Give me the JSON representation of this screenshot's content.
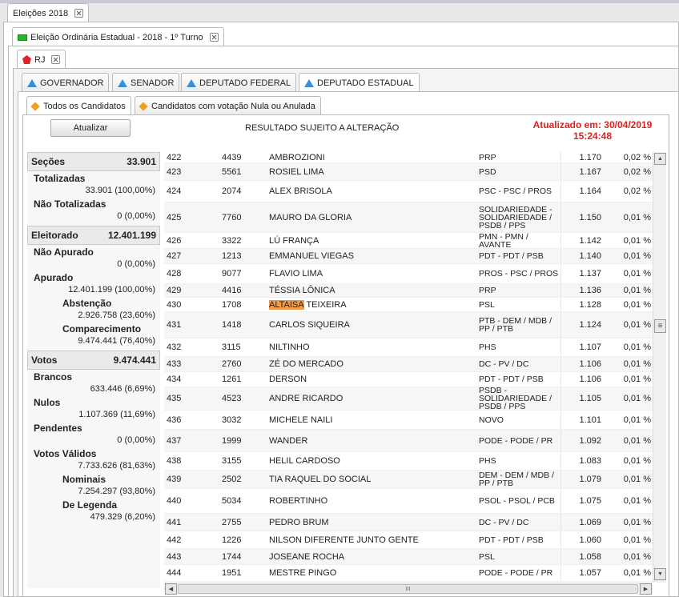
{
  "tabs": {
    "top": "Eleições 2018",
    "election": "Eleição Ordinária Estadual - 2018 - 1º Turno",
    "state": "RJ",
    "offices": [
      "GOVERNADOR",
      "SENADOR",
      "DEPUTADO FEDERAL",
      "DEPUTADO ESTADUAL"
    ],
    "filters": [
      "Todos os Candidatos",
      "Candidatos com votação Nula ou Anulada"
    ]
  },
  "toolbar": {
    "refresh_label": "Atualizar",
    "notice": "RESULTADO SUJEITO A ALTERAÇÃO",
    "updated_line1": "Atualizado em: 30/04/2019",
    "updated_line2": "15:24:48"
  },
  "stats": {
    "secoes_label": "Seções",
    "secoes_value": "33.901",
    "totalizadas_label": "Totalizadas",
    "totalizadas_value": "33.901 (100,00%)",
    "nao_totalizadas_label": "Não Totalizadas",
    "nao_totalizadas_value": "0 (0,00%)",
    "eleitorado_label": "Eleitorado",
    "eleitorado_value": "12.401.199",
    "nao_apurado_label": "Não Apurado",
    "nao_apurado_value": "0 (0,00%)",
    "apurado_label": "Apurado",
    "apurado_value": "12.401.199 (100,00%)",
    "abstencao_label": "Abstenção",
    "abstencao_value": "2.926.758 (23,60%)",
    "comparecimento_label": "Comparecimento",
    "comparecimento_value": "9.474.441 (76,40%)",
    "votos_label": "Votos",
    "votos_value": "9.474.441",
    "brancos_label": "Brancos",
    "brancos_value": "633.446 (6,69%)",
    "nulos_label": "Nulos",
    "nulos_value": "1.107.369 (11,69%)",
    "pendentes_label": "Pendentes",
    "pendentes_value": "0 (0,00%)",
    "validos_label": "Votos Válidos",
    "validos_value": "7.733.626 (81,63%)",
    "nominais_label": "Nominais",
    "nominais_value": "7.254.297 (93,80%)",
    "legenda_label": "De Legenda",
    "legenda_value": "479.329 (6,20%)"
  },
  "candidates": [
    {
      "pos": "422",
      "num": "4439",
      "name": "AMBROZIONI",
      "party": "PRP",
      "votes": "1.170",
      "pct": "0,02 %"
    },
    {
      "pos": "423",
      "num": "5561",
      "name": "ROSIEL LIMA",
      "party": "PSD",
      "votes": "1.167",
      "pct": "0,02 %"
    },
    {
      "pos": "424",
      "num": "2074",
      "name": "ALEX BRISOLA",
      "party": "PSC - PSC / PROS",
      "votes": "1.164",
      "pct": "0,02 %"
    },
    {
      "pos": "425",
      "num": "7760",
      "name": "MAURO DA GLORIA",
      "party": "SOLIDARIEDADE - SOLIDARIEDADE / PSDB / PPS",
      "votes": "1.150",
      "pct": "0,01 %"
    },
    {
      "pos": "426",
      "num": "3322",
      "name": "LÚ FRANÇA",
      "party": "PMN - PMN / AVANTE",
      "votes": "1.142",
      "pct": "0,01 %"
    },
    {
      "pos": "427",
      "num": "1213",
      "name": "EMMANUEL VIEGAS",
      "party": "PDT - PDT / PSB",
      "votes": "1.140",
      "pct": "0,01 %"
    },
    {
      "pos": "428",
      "num": "9077",
      "name": "FLAVIO LIMA",
      "party": "PROS - PSC / PROS",
      "votes": "1.137",
      "pct": "0,01 %"
    },
    {
      "pos": "429",
      "num": "4416",
      "name": "TÉSSIA LÔNICA",
      "party": "PRP",
      "votes": "1.136",
      "pct": "0,01 %"
    },
    {
      "pos": "430",
      "num": "1708",
      "name_hl": "ALTAISA",
      "name_rest": " TEIXEIRA",
      "party": "PSL",
      "votes": "1.128",
      "pct": "0,01 %"
    },
    {
      "pos": "431",
      "num": "1418",
      "name": "CARLOS SIQUEIRA",
      "party": "PTB - DEM / MDB / PP / PTB",
      "votes": "1.124",
      "pct": "0,01 %"
    },
    {
      "pos": "432",
      "num": "3115",
      "name": "NILTINHO",
      "party": "PHS",
      "votes": "1.107",
      "pct": "0,01 %"
    },
    {
      "pos": "433",
      "num": "2760",
      "name": "ZÉ DO MERCADO",
      "party": "DC - PV / DC",
      "votes": "1.106",
      "pct": "0,01 %"
    },
    {
      "pos": "434",
      "num": "1261",
      "name": "DERSON",
      "party": "PDT - PDT / PSB",
      "votes": "1.106",
      "pct": "0,01 %"
    },
    {
      "pos": "435",
      "num": "4523",
      "name": "ANDRE RICARDO",
      "party": "PSDB - SOLIDARIEDADE / PSDB / PPS",
      "votes": "1.105",
      "pct": "0,01 %"
    },
    {
      "pos": "436",
      "num": "3032",
      "name": "MICHELE NAILI",
      "party": "NOVO",
      "votes": "1.101",
      "pct": "0,01 %"
    },
    {
      "pos": "437",
      "num": "1999",
      "name": "WANDER",
      "party": "PODE - PODE / PR",
      "votes": "1.092",
      "pct": "0,01 %"
    },
    {
      "pos": "438",
      "num": "3155",
      "name": "HELIL CARDOSO",
      "party": "PHS",
      "votes": "1.083",
      "pct": "0,01 %"
    },
    {
      "pos": "439",
      "num": "2502",
      "name": "TIA RAQUEL DO SOCIAL",
      "party": "DEM - DEM / MDB / PP / PTB",
      "votes": "1.079",
      "pct": "0,01 %"
    },
    {
      "pos": "440",
      "num": "5034",
      "name": "ROBERTINHO",
      "party": "PSOL - PSOL / PCB",
      "votes": "1.075",
      "pct": "0,01 %"
    },
    {
      "pos": "441",
      "num": "2755",
      "name": "PEDRO BRUM",
      "party": "DC - PV / DC",
      "votes": "1.069",
      "pct": "0,01 %"
    },
    {
      "pos": "442",
      "num": "1226",
      "name": "NILSON DIFERENTE JUNTO GENTE",
      "party": "PDT - PDT / PSB",
      "votes": "1.060",
      "pct": "0,01 %"
    },
    {
      "pos": "443",
      "num": "1744",
      "name": "JOSEANE ROCHA",
      "party": "PSL",
      "votes": "1.058",
      "pct": "0,01 %"
    },
    {
      "pos": "444",
      "num": "1951",
      "name": "MESTRE PINGO",
      "party": "PODE - PODE / PR",
      "votes": "1.057",
      "pct": "0,01 %"
    }
  ],
  "scroll": {
    "grip": "≡",
    "h_grip": "III"
  },
  "colors": {
    "updated": "#d8231f",
    "highlight": "#f09b48",
    "office_icon": "#3a8fd4",
    "filter_icon": "#f0a020"
  }
}
